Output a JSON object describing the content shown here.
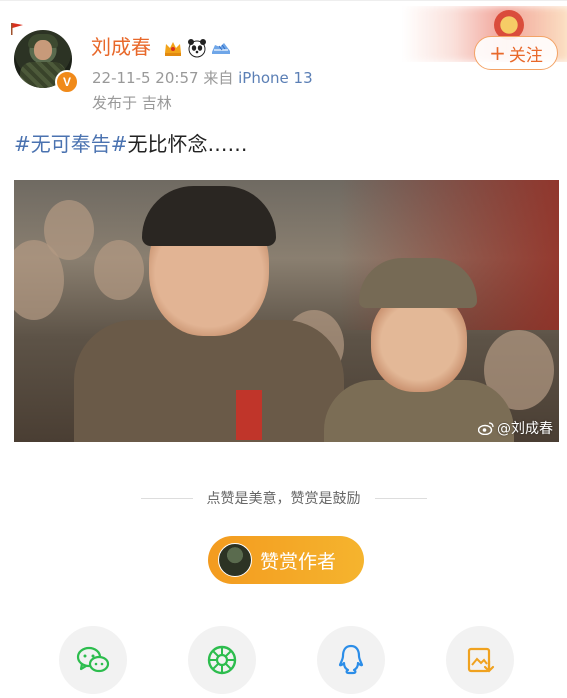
{
  "post": {
    "user_name": "刘成春",
    "verified_badge": "V",
    "timestamp": "22-11-5 20:57",
    "source_prefix": "来自",
    "device": "iPhone 13",
    "location": "发布于 吉林",
    "follow_label": "关注",
    "follow_plus": "+",
    "text_tag1": "#无可奉告#",
    "text_rest": "无比怀念……",
    "image_watermark": "@刘成春"
  },
  "reward": {
    "tagline": "点赞是美意，赞赏是鼓励",
    "button_label": "赞赏作者"
  },
  "share": {
    "icons": [
      "wechat-icon",
      "moments-icon",
      "qq-icon",
      "save-image-icon"
    ]
  },
  "colors": {
    "accent": "#e8682a",
    "link": "#4a72b0",
    "reward_gradient_start": "#f39b1f",
    "reward_gradient_end": "#f5b42e",
    "wechat_green": "#2dbd4e",
    "qq_blue": "#2b8de8",
    "save_orange": "#f0a21f"
  }
}
